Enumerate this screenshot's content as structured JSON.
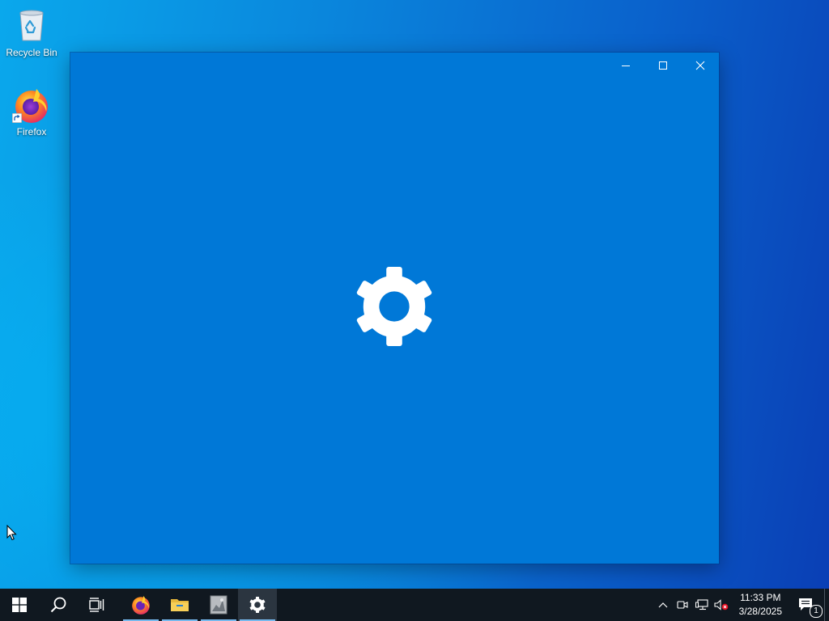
{
  "desktop": {
    "icons": [
      {
        "label": "Recycle Bin",
        "icon": "recycle-bin-icon"
      },
      {
        "label": "Firefox",
        "icon": "firefox-icon"
      }
    ]
  },
  "window": {
    "app": "Settings",
    "splash_icon": "gear-icon",
    "background": "#0078d7",
    "controls": [
      "minimize",
      "maximize",
      "close"
    ]
  },
  "taskbar": {
    "background": "#101820",
    "accent": "#76b9ed",
    "buttons": [
      {
        "name": "start",
        "icon": "windows-logo-icon"
      },
      {
        "name": "search",
        "icon": "search-icon"
      },
      {
        "name": "task-view",
        "icon": "task-view-icon"
      },
      {
        "name": "firefox",
        "icon": "firefox-icon",
        "running": true
      },
      {
        "name": "file-explorer",
        "icon": "folder-icon",
        "running": true
      },
      {
        "name": "app",
        "icon": "app-thumbnail-icon",
        "running": true
      },
      {
        "name": "settings",
        "icon": "gear-icon",
        "running": true,
        "active": true
      }
    ],
    "tray": {
      "icons": [
        "chevron-up-icon",
        "meet-now-icon",
        "network-icon",
        "volume-muted-icon"
      ],
      "time": "11:33 PM",
      "date": "3/28/2025",
      "notification_count": "1"
    }
  }
}
